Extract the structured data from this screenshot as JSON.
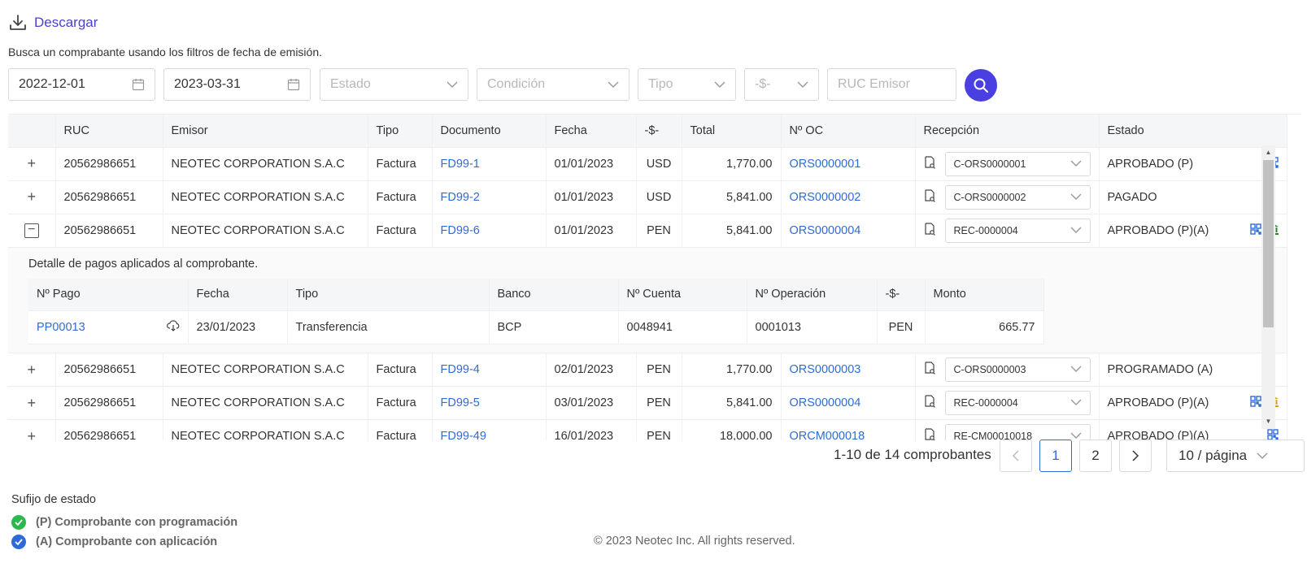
{
  "toolbar": {
    "download_label": "Descargar",
    "hint": "Busca un comprabante usando los filtros de fecha de emisión."
  },
  "filters": {
    "date_from": "2022-12-01",
    "date_to": "2023-03-31",
    "estado_placeholder": "Estado",
    "condicion_placeholder": "Condición",
    "tipo_placeholder": "Tipo",
    "moneda_placeholder": "-$-",
    "ruc_placeholder": "RUC Emisor"
  },
  "table": {
    "headers": {
      "ruc": "RUC",
      "emisor": "Emisor",
      "tipo": "Tipo",
      "documento": "Documento",
      "fecha": "Fecha",
      "moneda": "-$-",
      "total": "Total",
      "oc": "Nº OC",
      "recepcion": "Recepción",
      "estado": "Estado"
    },
    "rows": [
      {
        "ruc": "20562986651",
        "emisor": "NEOTEC CORPORATION S.A.C",
        "tipo": "Factura",
        "documento": "FD99-1",
        "fecha": "01/01/2023",
        "moneda": "USD",
        "total": "1,770.00",
        "oc": "ORS0000001",
        "recepcion": "C-ORS0000001",
        "estado": "APROBADO (P)"
      },
      {
        "ruc": "20562986651",
        "emisor": "NEOTEC CORPORATION S.A.C",
        "tipo": "Factura",
        "documento": "FD99-2",
        "fecha": "01/01/2023",
        "moneda": "USD",
        "total": "5,841.00",
        "oc": "ORS0000002",
        "recepcion": "C-ORS0000002",
        "estado": "PAGADO"
      },
      {
        "ruc": "20562986651",
        "emisor": "NEOTEC CORPORATION S.A.C",
        "tipo": "Factura",
        "documento": "FD99-6",
        "fecha": "01/01/2023",
        "moneda": "PEN",
        "total": "5,841.00",
        "oc": "ORS0000004",
        "recepcion": "REC-0000004",
        "estado": "APROBADO (P)(A)"
      },
      {
        "ruc": "20562986651",
        "emisor": "NEOTEC CORPORATION S.A.C",
        "tipo": "Factura",
        "documento": "FD99-4",
        "fecha": "02/01/2023",
        "moneda": "PEN",
        "total": "1,770.00",
        "oc": "ORS0000003",
        "recepcion": "C-ORS0000003",
        "estado": "PROGRAMADO (A)"
      },
      {
        "ruc": "20562986651",
        "emisor": "NEOTEC CORPORATION S.A.C",
        "tipo": "Factura",
        "documento": "FD99-5",
        "fecha": "03/01/2023",
        "moneda": "PEN",
        "total": "5,841.00",
        "oc": "ORS0000004",
        "recepcion": "REC-0000004",
        "estado": "APROBADO (P)(A)"
      },
      {
        "ruc": "20562986651",
        "emisor": "NEOTEC CORPORATION S.A.C",
        "tipo": "Factura",
        "documento": "FD99-49",
        "fecha": "16/01/2023",
        "moneda": "PEN",
        "total": "18,000.00",
        "oc": "ORCM000018",
        "recepcion": "RE-CM00010018",
        "estado": "APROBADO (P)(A)"
      }
    ],
    "detail": {
      "caption": "Detalle de pagos aplicados al comprobante.",
      "headers": {
        "pago": "Nº Pago",
        "fecha": "Fecha",
        "tipo": "Tipo",
        "banco": "Banco",
        "cuenta": "Nº Cuenta",
        "operacion": "Nº Operación",
        "moneda": "-$-",
        "monto": "Monto"
      },
      "row": {
        "pago": "PP00013",
        "fecha": "23/01/2023",
        "tipo": "Transferencia",
        "banco": "BCP",
        "cuenta": "0048941",
        "operacion": "0001013",
        "moneda": "PEN",
        "monto": "665.77"
      }
    }
  },
  "pagination": {
    "summary": "1-10 de 14 comprobantes",
    "page1": "1",
    "page2": "2",
    "page_size": "10 / página"
  },
  "legend": {
    "title": "Sufijo de estado",
    "p_label": "(P) Comprobante con programación",
    "a_label": "(A) Comprobante con aplicación"
  },
  "footer": "© 2023 Neotec Inc. All rights reserved.",
  "colors": {
    "accent": "#4a3fe0",
    "link": "#2f6bd8",
    "green": "#2db84d",
    "blue": "#2f6bd8",
    "bank_green": "#2e7d32",
    "bank_gold": "#d4a017"
  },
  "icons": [
    "download-icon",
    "calendar-icon",
    "chevron-down-icon",
    "search-icon",
    "expand-icon",
    "collapse-icon",
    "reception-doc-icon",
    "qr-icon",
    "bank-icon",
    "cloud-download-icon",
    "check-circle-icon"
  ]
}
